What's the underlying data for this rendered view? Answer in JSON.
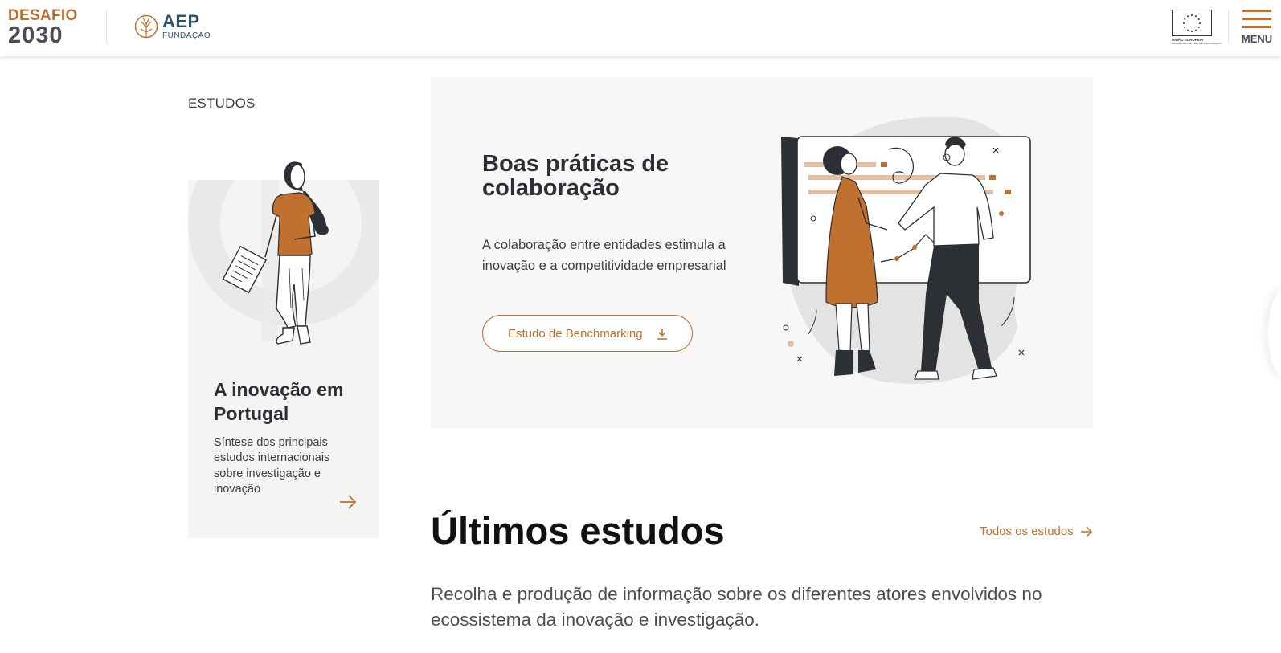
{
  "header": {
    "logo_line1": "DESAFIO",
    "logo_line2": "2030",
    "aep_name": "AEP",
    "aep_sub": "FUNDAÇÃO",
    "eu_caption_line1": "UNIÃO EUROPEIA",
    "eu_caption_line2": "Fundo Europeu de Desenvolvimento Regional",
    "menu_label": "MENU"
  },
  "section": {
    "label": "ESTUDOS"
  },
  "side_card": {
    "title": "A inovação em Portugal",
    "description": "Síntese dos principais estudos internacionais sobre investigação e inovação"
  },
  "hero": {
    "title": "Boas práticas de colaboração",
    "description": "A colaboração entre entidades estimula a inovação e a competitividade empresarial",
    "button_label": "Estudo de Benchmarking"
  },
  "latest": {
    "title": "Últimos estudos",
    "all_link": "Todos os estudos",
    "description": "Recolha e produção de informação sobre os diferentes atores envolvidos no ecossistema da inovação e investigação."
  },
  "colors": {
    "accent": "#c0702f",
    "dark": "#2c2f33",
    "card_bg": "#f4f4f4",
    "hero_bg": "#f7f7f7"
  },
  "icons": {
    "menu": "hamburger-icon",
    "download": "download-icon",
    "arrow": "arrow-right-icon"
  }
}
